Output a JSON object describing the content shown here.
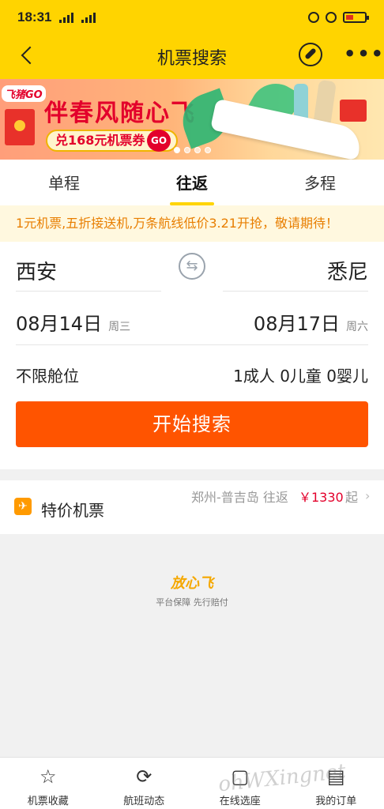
{
  "status_bar": {
    "time": "18:31",
    "network_a": "2G",
    "network_b": "4G"
  },
  "header": {
    "title": "机票搜索"
  },
  "banner": {
    "logo": "飞猪GO",
    "headline": "伴春风随心飞",
    "coupon": "兑168元机票券",
    "go": "GO"
  },
  "tabs": [
    {
      "label": "单程"
    },
    {
      "label": "往返"
    },
    {
      "label": "多程"
    }
  ],
  "notice": "1元机票,五折接送机,万条航线低价3.21开抢，敬请期待！",
  "search": {
    "from_city": "西安",
    "to_city": "悉尼",
    "depart_date": "08月14日",
    "depart_weekday": "周三",
    "return_date": "08月17日",
    "return_weekday": "周六",
    "cabin": "不限舱位",
    "passengers": "1成人 0儿童 0婴儿",
    "button": "开始搜索"
  },
  "special": {
    "title": "特价机票",
    "route": "郑州-普吉岛 往返",
    "price": "￥1330",
    "unit": "起"
  },
  "assurance": {
    "brand": "放心飞",
    "tagline": "平台保障 先行赔付"
  },
  "bottom_nav": [
    {
      "label": "机票收藏",
      "icon": "star-icon"
    },
    {
      "label": "航班动态",
      "icon": "flight-status-icon"
    },
    {
      "label": "在线选座",
      "icon": "seat-icon"
    },
    {
      "label": "我的订单",
      "icon": "order-icon"
    }
  ],
  "watermark": "ohWXingnet",
  "colors": {
    "brand_yellow": "#ffd400",
    "search_orange": "#ff5400",
    "price_red": "#e3002b",
    "notice_orange": "#e87e00"
  }
}
